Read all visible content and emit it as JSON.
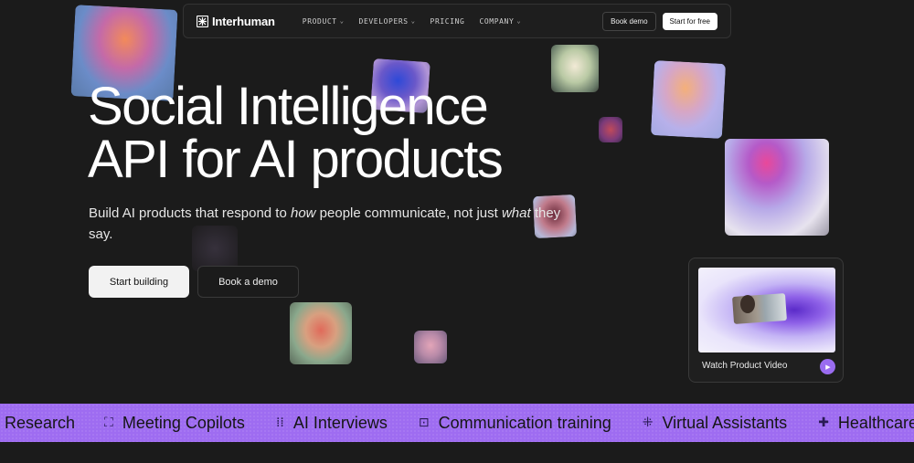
{
  "nav": {
    "logo": "Interhuman",
    "menu": [
      {
        "label": "PRODUCT",
        "has_dropdown": true
      },
      {
        "label": "DEVELOPERS",
        "has_dropdown": true
      },
      {
        "label": "PRICING",
        "has_dropdown": false
      },
      {
        "label": "COMPANY",
        "has_dropdown": true
      }
    ],
    "book_demo": "Book demo",
    "start_free": "Start for free"
  },
  "hero": {
    "headline_line1": "Social Intelligence",
    "headline_line2": "API for AI products",
    "sub_part1": "Build AI products that respond to ",
    "sub_em1": "how",
    "sub_part2": " people communicate, not just ",
    "sub_em2": "what",
    "sub_part3": " they say.",
    "cta_primary": "Start building",
    "cta_secondary": "Book a demo"
  },
  "video": {
    "label": "Watch Product Video"
  },
  "band": {
    "items": [
      {
        "icon": "research-icon",
        "label": "Research"
      },
      {
        "icon": "meeting-copilots-icon",
        "label": "Meeting Copilots"
      },
      {
        "icon": "ai-interviews-icon",
        "label": "AI Interviews"
      },
      {
        "icon": "communication-training-icon",
        "label": "Communication training"
      },
      {
        "icon": "virtual-assistants-icon",
        "label": "Virtual Assistants"
      },
      {
        "icon": "healthcare-icon",
        "label": "Healthcare"
      }
    ]
  },
  "colors": {
    "background": "#1b1b1b",
    "accent": "#9e6cf1",
    "play_button": "#9a6cf0"
  }
}
